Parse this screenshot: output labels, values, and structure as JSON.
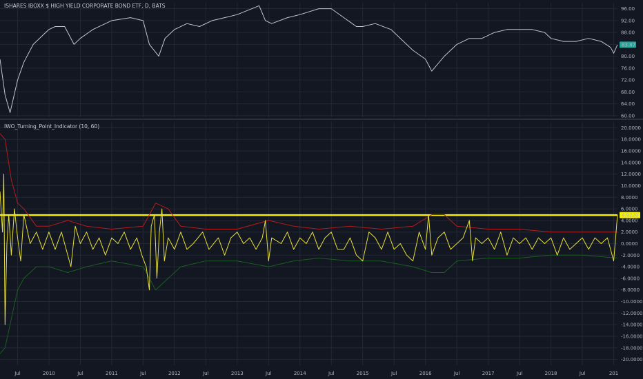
{
  "colors": {
    "background": "#131722",
    "grid": "#232834",
    "axis_text": "#b2b5be",
    "price_line": "#c3c6cf",
    "price_tag": "#26a69a",
    "indicator": "#e8e03a",
    "upper_band": "#b71c1c",
    "lower_band": "#1b5e20",
    "threshold": "#f5f000",
    "indicator_tag": "#f5f000"
  },
  "chart_data": [
    {
      "type": "line",
      "title": "ISHARES IBOXX $ HIGH YIELD CORPORATE BOND ETF, D, BATS",
      "ylim": [
        59.5,
        98.0
      ],
      "y_ticks": [
        "96.00",
        "92.00",
        "88.00",
        "84.00",
        "80.00",
        "76.00",
        "72.00",
        "68.00",
        "64.00",
        "60.00"
      ],
      "last_value": "83.87",
      "x_time_range": [
        2009.22,
        2019.06
      ],
      "series": [
        {
          "points": [
            [
              2009.22,
              79
            ],
            [
              2009.3,
              67
            ],
            [
              2009.38,
              61
            ],
            [
              2009.5,
              72
            ],
            [
              2009.6,
              78
            ],
            [
              2009.75,
              84
            ],
            [
              2009.9,
              87
            ],
            [
              2010.0,
              89
            ],
            [
              2010.1,
              90
            ],
            [
              2010.25,
              90
            ],
            [
              2010.4,
              84
            ],
            [
              2010.5,
              86
            ],
            [
              2010.7,
              89
            ],
            [
              2011.0,
              92
            ],
            [
              2011.3,
              93
            ],
            [
              2011.5,
              92
            ],
            [
              2011.6,
              84
            ],
            [
              2011.75,
              80
            ],
            [
              2011.85,
              86
            ],
            [
              2012.0,
              89
            ],
            [
              2012.2,
              91
            ],
            [
              2012.4,
              90
            ],
            [
              2012.6,
              92
            ],
            [
              2012.8,
              93
            ],
            [
              2013.0,
              94
            ],
            [
              2013.35,
              97
            ],
            [
              2013.45,
              92
            ],
            [
              2013.55,
              91
            ],
            [
              2013.8,
              93
            ],
            [
              2014.0,
              94
            ],
            [
              2014.3,
              96
            ],
            [
              2014.5,
              96
            ],
            [
              2014.7,
              93
            ],
            [
              2014.9,
              90
            ],
            [
              2015.0,
              90
            ],
            [
              2015.2,
              91
            ],
            [
              2015.45,
              89
            ],
            [
              2015.6,
              86
            ],
            [
              2015.8,
              82
            ],
            [
              2016.0,
              79
            ],
            [
              2016.1,
              75
            ],
            [
              2016.3,
              80
            ],
            [
              2016.5,
              84
            ],
            [
              2016.7,
              86
            ],
            [
              2016.9,
              86
            ],
            [
              2017.1,
              88
            ],
            [
              2017.3,
              89
            ],
            [
              2017.5,
              89
            ],
            [
              2017.7,
              89
            ],
            [
              2017.9,
              88
            ],
            [
              2018.0,
              86
            ],
            [
              2018.2,
              85
            ],
            [
              2018.4,
              85
            ],
            [
              2018.6,
              86
            ],
            [
              2018.8,
              85
            ],
            [
              2018.95,
              83
            ],
            [
              2019.0,
              81
            ],
            [
              2019.06,
              83.87
            ]
          ]
        }
      ]
    },
    {
      "type": "line",
      "title": "IWO_Turning_Point_Indicator (10, 60)",
      "ylim": [
        -21.0,
        21.0
      ],
      "y_ticks": [
        "20.0000",
        "18.0000",
        "16.0000",
        "14.0000",
        "12.0000",
        "10.0000",
        "8.0000",
        "6.0000",
        "4.0000",
        "2.0000",
        "0.0000",
        "-2.0000",
        "-4.0000",
        "-6.0000",
        "-8.0000",
        "-10.0000",
        "-12.0000",
        "-14.0000",
        "-16.0000",
        "-18.0000",
        "-20.0000"
      ],
      "threshold_value": 4.922,
      "last_value": "4.9220",
      "x_time_range": [
        2009.22,
        2019.06
      ],
      "series": [
        {
          "points": [
            [
              2009.22,
              9
            ],
            [
              2009.26,
              2
            ],
            [
              2009.28,
              12
            ],
            [
              2009.3,
              -14
            ],
            [
              2009.33,
              0
            ],
            [
              2009.36,
              5
            ],
            [
              2009.4,
              -2
            ],
            [
              2009.45,
              6
            ],
            [
              2009.5,
              1
            ],
            [
              2009.55,
              -3
            ],
            [
              2009.6,
              5
            ],
            [
              2009.7,
              0
            ],
            [
              2009.8,
              2
            ],
            [
              2009.9,
              -1
            ],
            [
              2010.0,
              2
            ],
            [
              2010.1,
              -1
            ],
            [
              2010.2,
              2
            ],
            [
              2010.3,
              -2
            ],
            [
              2010.35,
              -4
            ],
            [
              2010.42,
              3
            ],
            [
              2010.5,
              0
            ],
            [
              2010.6,
              2
            ],
            [
              2010.7,
              -1
            ],
            [
              2010.8,
              1
            ],
            [
              2010.9,
              -2
            ],
            [
              2011.0,
              1
            ],
            [
              2011.1,
              0
            ],
            [
              2011.2,
              2
            ],
            [
              2011.3,
              -1
            ],
            [
              2011.4,
              1
            ],
            [
              2011.48,
              -2
            ],
            [
              2011.55,
              -4
            ],
            [
              2011.6,
              -8
            ],
            [
              2011.63,
              3
            ],
            [
              2011.68,
              5
            ],
            [
              2011.72,
              -6
            ],
            [
              2011.76,
              2
            ],
            [
              2011.8,
              6
            ],
            [
              2011.84,
              -3
            ],
            [
              2011.9,
              1
            ],
            [
              2012.0,
              -1
            ],
            [
              2012.1,
              2
            ],
            [
              2012.2,
              -1
            ],
            [
              2012.3,
              0
            ],
            [
              2012.45,
              2
            ],
            [
              2012.55,
              -1
            ],
            [
              2012.7,
              1
            ],
            [
              2012.8,
              -2
            ],
            [
              2012.9,
              1
            ],
            [
              2013.0,
              2
            ],
            [
              2013.1,
              0
            ],
            [
              2013.2,
              1
            ],
            [
              2013.3,
              -1
            ],
            [
              2013.4,
              1
            ],
            [
              2013.45,
              4
            ],
            [
              2013.5,
              -3
            ],
            [
              2013.55,
              1
            ],
            [
              2013.7,
              0
            ],
            [
              2013.8,
              2
            ],
            [
              2013.9,
              -1
            ],
            [
              2014.0,
              1
            ],
            [
              2014.1,
              0
            ],
            [
              2014.2,
              2
            ],
            [
              2014.3,
              -1
            ],
            [
              2014.4,
              1
            ],
            [
              2014.5,
              2
            ],
            [
              2014.6,
              -1
            ],
            [
              2014.7,
              -1
            ],
            [
              2014.8,
              1
            ],
            [
              2014.9,
              -2
            ],
            [
              2015.0,
              -3
            ],
            [
              2015.1,
              2
            ],
            [
              2015.2,
              1
            ],
            [
              2015.3,
              -1
            ],
            [
              2015.4,
              2
            ],
            [
              2015.5,
              -1
            ],
            [
              2015.6,
              0
            ],
            [
              2015.7,
              -2
            ],
            [
              2015.8,
              -3
            ],
            [
              2015.9,
              2
            ],
            [
              2016.0,
              -1
            ],
            [
              2016.05,
              5
            ],
            [
              2016.1,
              -2
            ],
            [
              2016.2,
              1
            ],
            [
              2016.3,
              2
            ],
            [
              2016.4,
              -1
            ],
            [
              2016.5,
              0
            ],
            [
              2016.6,
              1
            ],
            [
              2016.7,
              4
            ],
            [
              2016.75,
              -3
            ],
            [
              2016.8,
              1
            ],
            [
              2016.9,
              0
            ],
            [
              2017.0,
              1
            ],
            [
              2017.1,
              -1
            ],
            [
              2017.2,
              2
            ],
            [
              2017.3,
              -2
            ],
            [
              2017.4,
              1
            ],
            [
              2017.5,
              0
            ],
            [
              2017.6,
              1
            ],
            [
              2017.7,
              -1
            ],
            [
              2017.8,
              1
            ],
            [
              2017.9,
              0
            ],
            [
              2018.0,
              1
            ],
            [
              2018.1,
              -2
            ],
            [
              2018.2,
              1
            ],
            [
              2018.3,
              -1
            ],
            [
              2018.4,
              0
            ],
            [
              2018.5,
              1
            ],
            [
              2018.6,
              -1
            ],
            [
              2018.7,
              1
            ],
            [
              2018.8,
              0
            ],
            [
              2018.9,
              1
            ],
            [
              2018.95,
              -1
            ],
            [
              2019.0,
              -3
            ],
            [
              2019.03,
              1
            ],
            [
              2019.06,
              4.922
            ]
          ]
        },
        {
          "points": [
            [
              2009.22,
              19
            ],
            [
              2009.3,
              18
            ],
            [
              2009.4,
              11
            ],
            [
              2009.5,
              7
            ],
            [
              2009.6,
              6
            ],
            [
              2009.8,
              3
            ],
            [
              2010.0,
              3
            ],
            [
              2010.3,
              4
            ],
            [
              2010.6,
              3
            ],
            [
              2011.0,
              2.5
            ],
            [
              2011.5,
              3
            ],
            [
              2011.7,
              7
            ],
            [
              2011.9,
              6
            ],
            [
              2012.1,
              3
            ],
            [
              2012.5,
              2.5
            ],
            [
              2013.0,
              2.5
            ],
            [
              2013.5,
              4
            ],
            [
              2013.9,
              3
            ],
            [
              2014.3,
              2.5
            ],
            [
              2014.8,
              3
            ],
            [
              2015.3,
              2.5
            ],
            [
              2015.8,
              3
            ],
            [
              2016.1,
              5
            ],
            [
              2016.3,
              5
            ],
            [
              2016.5,
              3
            ],
            [
              2017.0,
              2.5
            ],
            [
              2017.5,
              2.5
            ],
            [
              2018.0,
              2
            ],
            [
              2018.5,
              2
            ],
            [
              2019.06,
              2
            ]
          ]
        },
        {
          "points": [
            [
              2009.22,
              -19
            ],
            [
              2009.3,
              -18
            ],
            [
              2009.4,
              -13
            ],
            [
              2009.5,
              -8
            ],
            [
              2009.6,
              -6
            ],
            [
              2009.8,
              -4
            ],
            [
              2010.0,
              -4
            ],
            [
              2010.3,
              -5
            ],
            [
              2010.6,
              -4
            ],
            [
              2011.0,
              -3
            ],
            [
              2011.5,
              -4
            ],
            [
              2011.7,
              -8
            ],
            [
              2011.9,
              -6
            ],
            [
              2012.1,
              -4
            ],
            [
              2012.5,
              -3
            ],
            [
              2013.0,
              -3
            ],
            [
              2013.5,
              -4
            ],
            [
              2013.9,
              -3
            ],
            [
              2014.3,
              -2.5
            ],
            [
              2014.8,
              -3
            ],
            [
              2015.3,
              -3
            ],
            [
              2015.8,
              -4
            ],
            [
              2016.1,
              -5
            ],
            [
              2016.3,
              -5
            ],
            [
              2016.5,
              -3
            ],
            [
              2017.0,
              -2.5
            ],
            [
              2017.5,
              -2.5
            ],
            [
              2018.0,
              -2
            ],
            [
              2018.5,
              -2
            ],
            [
              2019.06,
              -2.5
            ]
          ]
        }
      ]
    }
  ],
  "x_axis": {
    "ticks": [
      {
        "t": 2009.5,
        "label": "Jul"
      },
      {
        "t": 2010.0,
        "label": "2010"
      },
      {
        "t": 2010.5,
        "label": "Jul"
      },
      {
        "t": 2011.0,
        "label": "2011"
      },
      {
        "t": 2011.5,
        "label": "Jul"
      },
      {
        "t": 2012.0,
        "label": "2012"
      },
      {
        "t": 2012.5,
        "label": "Jul"
      },
      {
        "t": 2013.0,
        "label": "2013"
      },
      {
        "t": 2013.5,
        "label": "Jul"
      },
      {
        "t": 2014.0,
        "label": "2014"
      },
      {
        "t": 2014.5,
        "label": "Jul"
      },
      {
        "t": 2015.0,
        "label": "2015"
      },
      {
        "t": 2015.5,
        "label": "Jul"
      },
      {
        "t": 2016.0,
        "label": "2016"
      },
      {
        "t": 2016.5,
        "label": "Jul"
      },
      {
        "t": 2017.0,
        "label": "2017"
      },
      {
        "t": 2017.5,
        "label": "Jul"
      },
      {
        "t": 2018.0,
        "label": "2018"
      },
      {
        "t": 2018.5,
        "label": "Jul"
      },
      {
        "t": 2019.0,
        "label": "201"
      }
    ]
  }
}
